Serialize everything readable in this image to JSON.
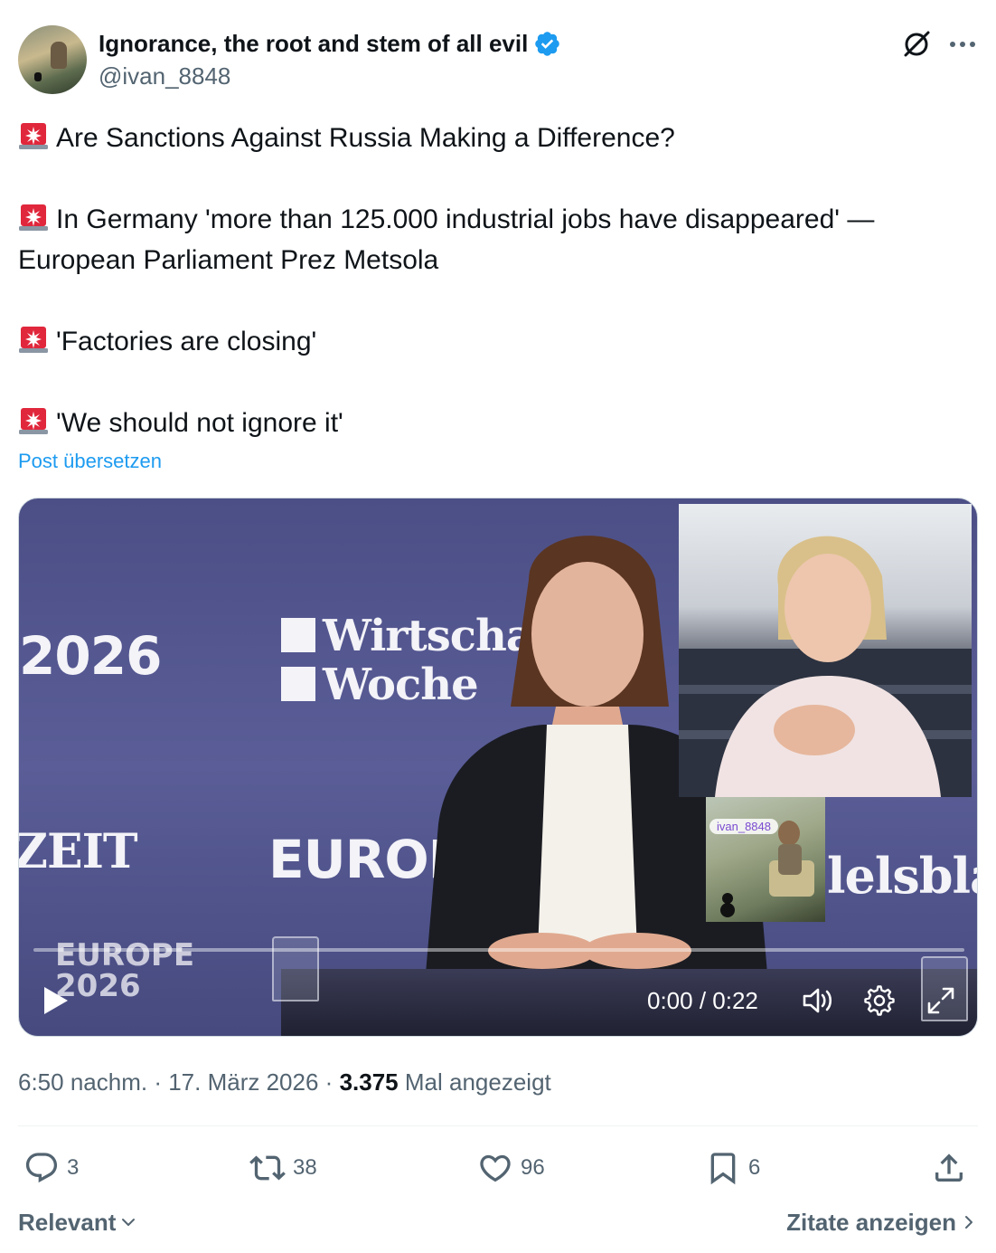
{
  "author": {
    "display_name": "Ignorance, the root and stem of all evil",
    "handle": "@ivan_8848",
    "verified": true
  },
  "post": {
    "paragraphs": [
      {
        "emoji": "rotating-light",
        "text": "Are Sanctions Against Russia Making a Difference?"
      },
      {
        "emoji": "rotating-light",
        "text": "In Germany 'more than 125.000 industrial jobs have disappeared' — European Parliament Prez Metsola"
      },
      {
        "emoji": "rotating-light",
        "text": "'Factories are closing'"
      },
      {
        "emoji": "rotating-light",
        "text": "'We should not ignore it'"
      }
    ],
    "translate_label": "Post übersetzen"
  },
  "video": {
    "backdrop_texts": {
      "year": "2026",
      "wiwo_line1": "Wirtschafts",
      "wiwo_line2": "Woche",
      "zeit": "ZEIT",
      "europe": "EUROPE",
      "handelsblatt": "lelsblatt",
      "logo_line1": "EUROPE",
      "logo_line2": "2026"
    },
    "pip_watermark": "ivan_8848",
    "time": "0:00 / 0:22",
    "progress": 0.0
  },
  "meta": {
    "time": "6:50 nachm.",
    "date": "17. März 2026",
    "views": "3.375",
    "views_label": "Mal angezeigt"
  },
  "actions": {
    "replies": "3",
    "reposts": "38",
    "likes": "96",
    "bookmarks": "6"
  },
  "footer": {
    "sort_label": "Relevant",
    "quotes_label": "Zitate anzeigen"
  },
  "colors": {
    "accent": "#1d9bf0",
    "secondary_text": "#536471",
    "verified": "#1d9bf0"
  }
}
